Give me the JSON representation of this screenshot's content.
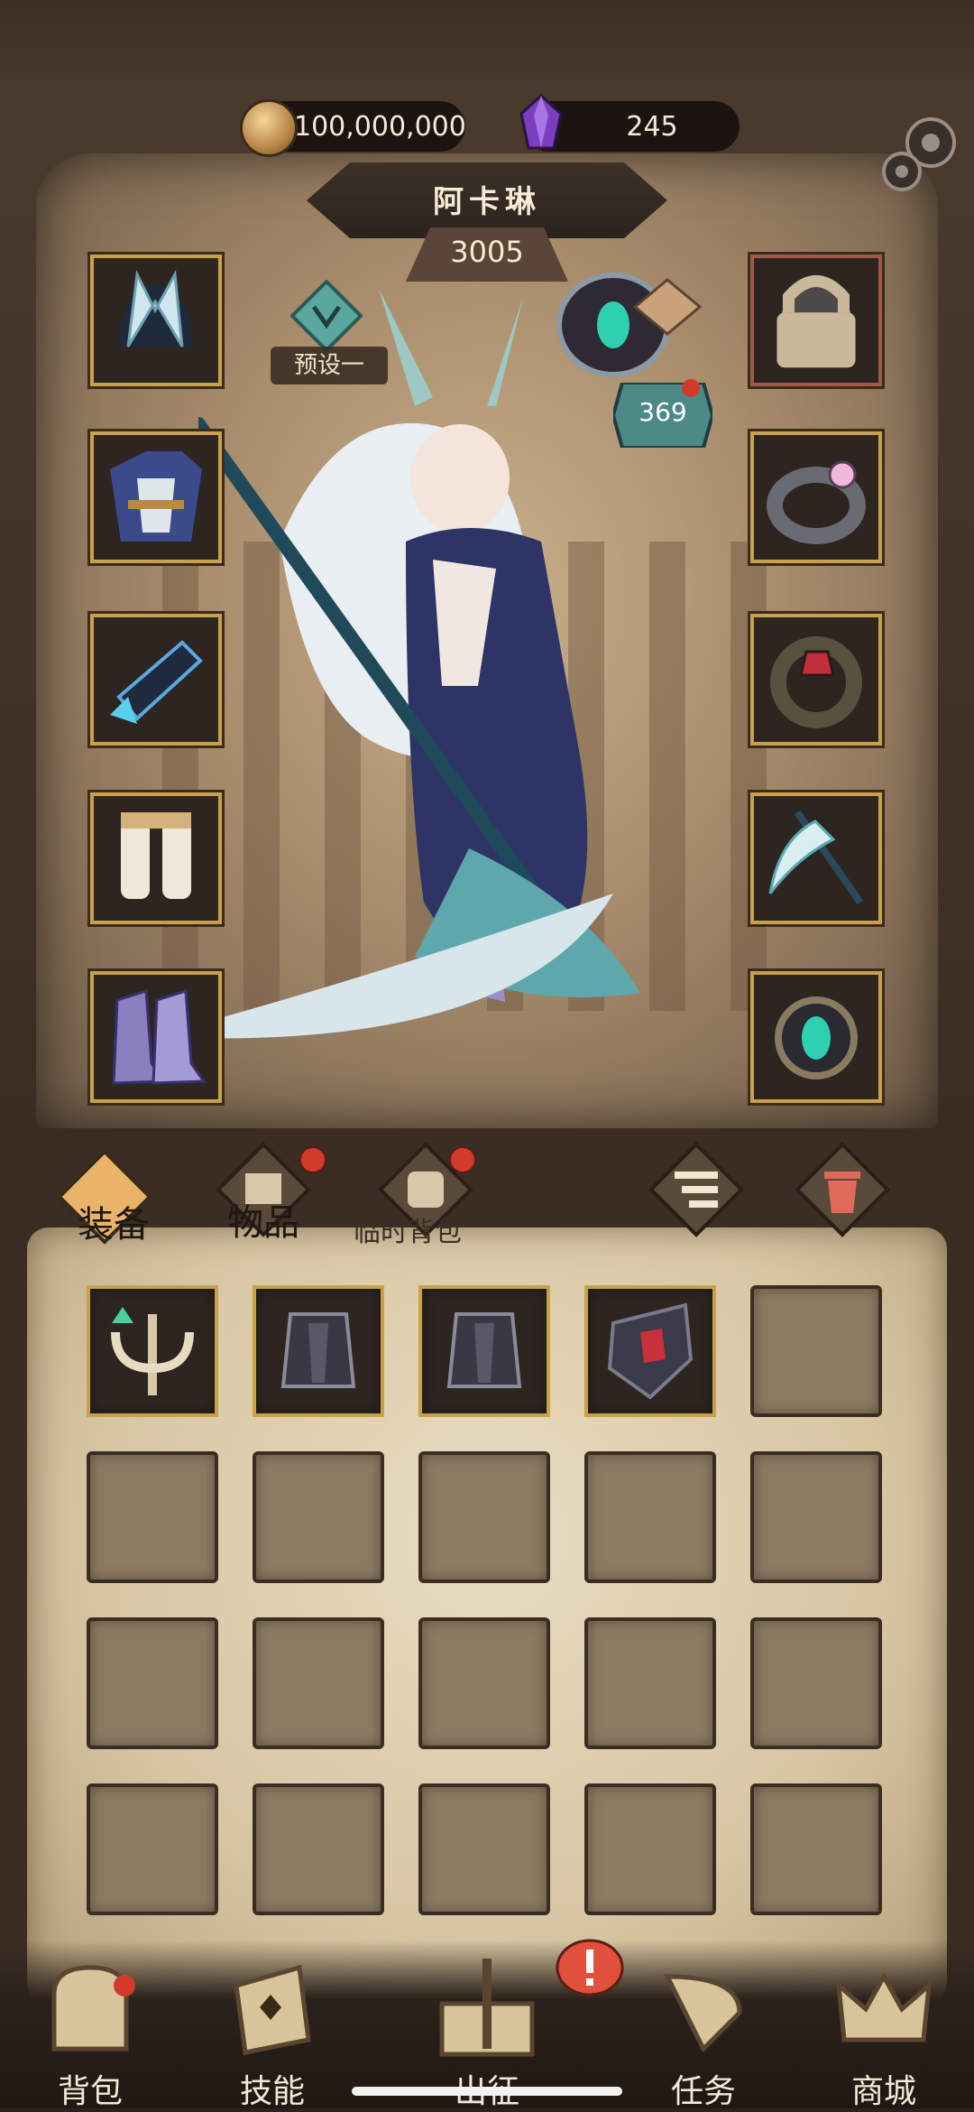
{
  "currency": {
    "gold": "100,000,000",
    "gems": "245"
  },
  "hero": {
    "name": "阿卡琳",
    "power": "3005",
    "preset": "预设一",
    "level": "369"
  },
  "tabs": {
    "equipment": "装备",
    "items": "物品",
    "temp_bag": "临时背包"
  },
  "equipment_slots_left": [
    "helmet-item-icon",
    "armor-item-icon",
    "gauntlet-item-icon",
    "greaves-item-icon",
    "boots-item-icon"
  ],
  "equipment_slots_right": [
    "locked-helmet-item-icon",
    "ring-item-icon",
    "serpent-ring-item-icon",
    "scythe-item-icon",
    "amulet-item-icon"
  ],
  "bag_items": [
    "candelabra-item-icon",
    "iron-armor-item-icon",
    "iron-armor-item-icon",
    "shield-item-icon"
  ],
  "nav": {
    "bag": "背包",
    "skills": "技能",
    "expedition": "出征",
    "quests": "任务",
    "shop": "商城"
  },
  "colors": {
    "accent_gold": "#c7a24a",
    "badge_red": "#d23b2a",
    "parchment": "#e9dcc1"
  }
}
